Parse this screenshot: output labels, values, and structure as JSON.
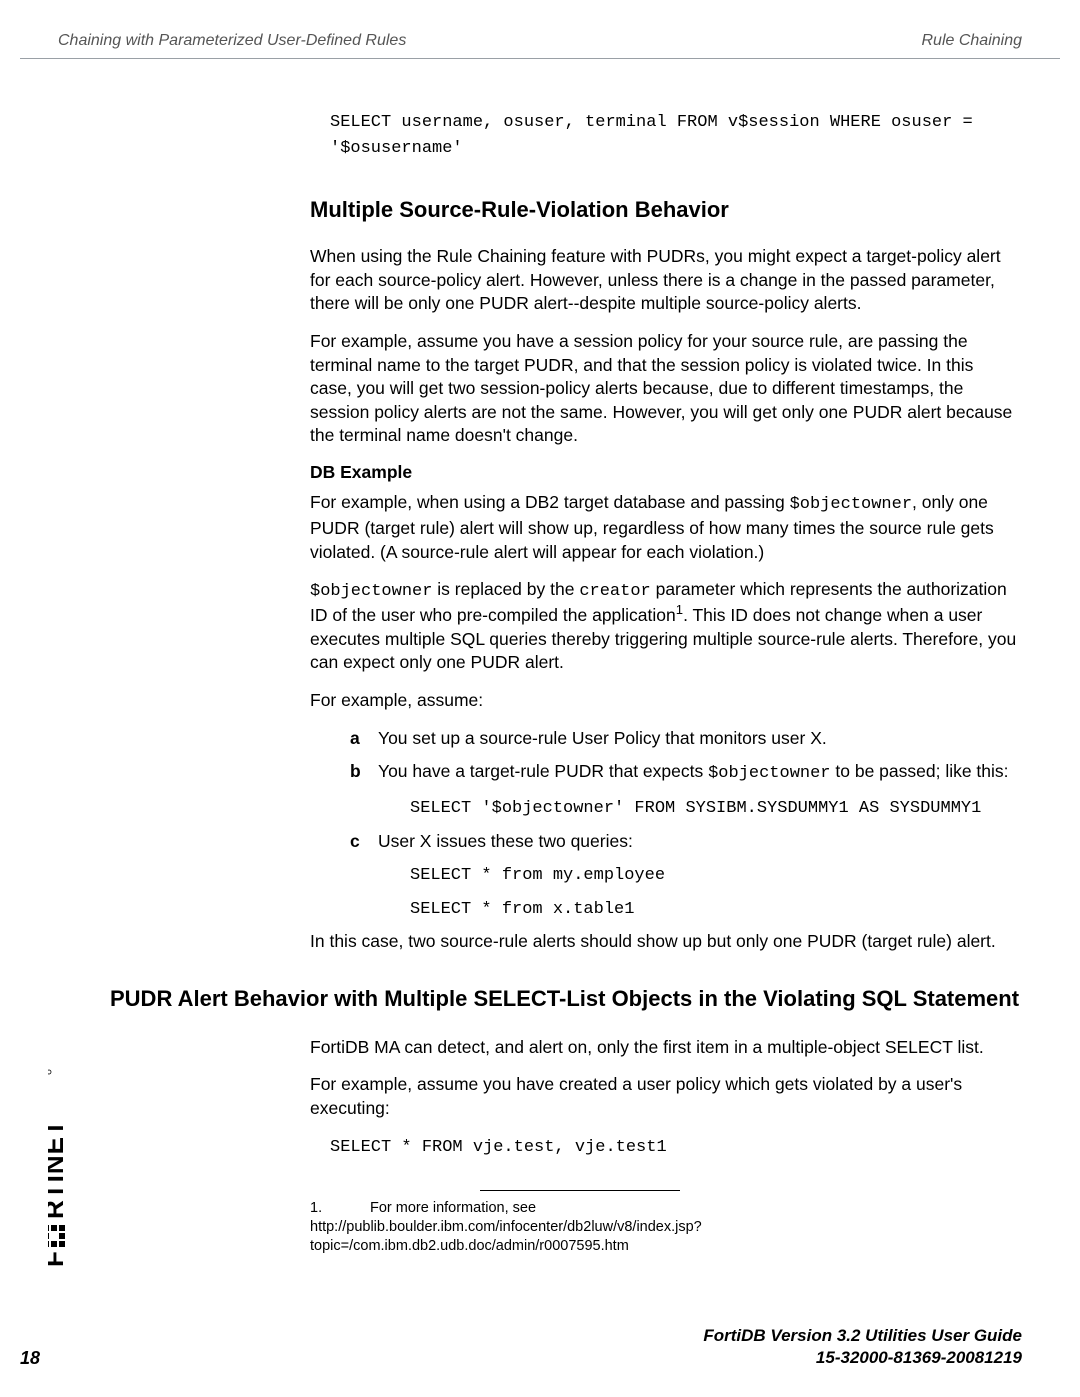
{
  "header": {
    "left": "Chaining with Parameterized User-Defined Rules",
    "right": "Rule Chaining"
  },
  "code1": "SELECT username, osuser, terminal FROM v$session WHERE osuser = '$osusername'",
  "h2a": "Multiple Source-Rule-Violation Behavior",
  "p1": "When using the Rule Chaining feature with PUDRs, you might expect a target-policy alert for each source-policy alert. However, unless there is a change in the passed parameter, there will be only one PUDR alert--despite multiple source-policy alerts.",
  "p2": "For example, assume you have a session policy for your source rule, are passing the terminal name to the target PUDR, and that the session policy is violated twice. In this case, you will get two session-policy alerts because, due to different timestamps, the session policy alerts are not the same. However, you will get only one PUDR alert because the terminal name doesn't change.",
  "sub1": "DB Example",
  "p3_pre": "For example, when using a DB2 target database and passing ",
  "p3_code": "$objectowner",
  "p3_post": ", only one PUDR (target rule) alert will show up, regardless of how many times the source rule gets violated. (A source-rule alert will appear for each violation.)",
  "p4_code1": "$objectowner",
  "p4_mid1": " is replaced by the ",
  "p4_code2": "creator",
  "p4_mid2": " parameter which represents the authorization ID of the user who pre-compiled the application",
  "p4_sup": "1",
  "p4_post": ". This ID does not change when a user executes multiple SQL queries thereby triggering multiple source-rule alerts. Therefore, you can expect only one PUDR alert.",
  "p5": "For example, assume:",
  "la_m": "a",
  "la_t": "You set up a source-rule User Policy that monitors user X.",
  "lb_m": "b",
  "lb_t_pre": "You have a target-rule PUDR that expects ",
  "lb_t_code": "$objectowner",
  "lb_t_post": " to be passed; like this:",
  "lb_code": "SELECT '$objectowner' FROM SYSIBM.SYSDUMMY1 AS SYSDUMMY1",
  "lc_m": "c",
  "lc_t": "User X issues these two queries:",
  "lc_code1": "SELECT * from my.employee",
  "lc_code2": "SELECT * from x.table1",
  "p6": "In this case, two source-rule alerts should show up but only one PUDR (target rule) alert.",
  "h1b": "PUDR Alert Behavior with Multiple SELECT-List Objects in the Violating SQL Statement",
  "p7": "FortiDB MA can detect, and alert on, only the first item in a multiple-object SELECT list.",
  "p8": "For example, assume you have created a user policy which gets violated by a user's executing:",
  "code2": "SELECT * FROM vje.test, vje.test1",
  "footnote": {
    "num": "1.",
    "lead": "For more information, see",
    "url": "http://publib.boulder.ibm.com/infocenter/db2luw/v8/index.jsp?topic=/com.ibm.db2.udb.doc/admin/r0007595.htm"
  },
  "footer": {
    "page": "18",
    "line1": "FortiDB Version 3.2 Utilities  User Guide",
    "line2": "15-32000-81369-20081219"
  }
}
